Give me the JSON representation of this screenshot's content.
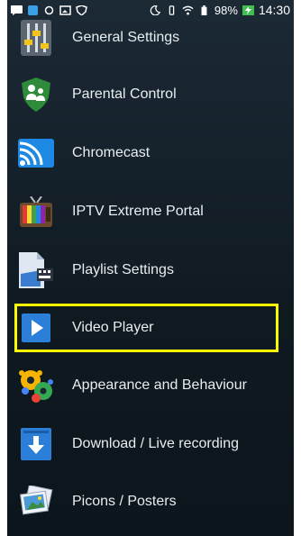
{
  "status_bar": {
    "battery": "98%",
    "time": "14:30"
  },
  "menu": {
    "items": [
      {
        "label": "General Settings",
        "icon": "sliders-icon"
      },
      {
        "label": "Parental Control",
        "icon": "parental-shield-icon"
      },
      {
        "label": "Chromecast",
        "icon": "chromecast-icon"
      },
      {
        "label": "IPTV Extreme Portal",
        "icon": "tv-icon"
      },
      {
        "label": "Playlist Settings",
        "icon": "playlist-file-icon"
      },
      {
        "label": "Video Player",
        "icon": "play-icon"
      },
      {
        "label": "Appearance and Behaviour",
        "icon": "gears-icon"
      },
      {
        "label": "Download / Live recording",
        "icon": "download-icon"
      },
      {
        "label": "Picons / Posters",
        "icon": "pictures-icon"
      }
    ],
    "highlighted_item": "Video Player"
  },
  "colors": {
    "highlight": "#ffff00",
    "chromecast_blue": "#1e88e5",
    "parental_green": "#2e8b3a",
    "play_blue": "#2b7fd9"
  }
}
